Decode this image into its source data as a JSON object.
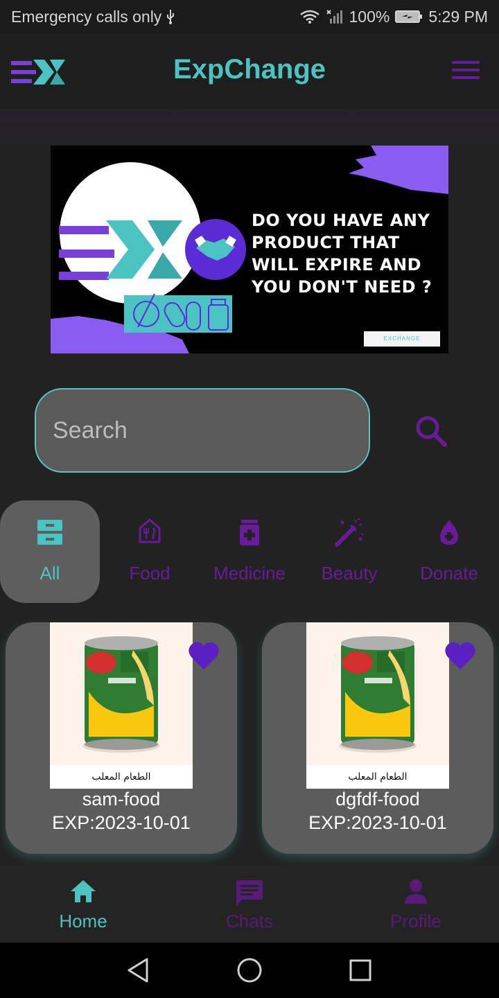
{
  "status_bar": {
    "carrier_text": "Emergency calls only",
    "battery": "100%",
    "time": "5:29 PM",
    "icons": [
      "usb-icon",
      "wifi-icon",
      "signal-icon",
      "battery-charging-icon"
    ]
  },
  "app_bar": {
    "title": "ExpChange",
    "logo_icon": "expchange-logo-icon",
    "menu_icon": "hamburger-menu-icon"
  },
  "banner": {
    "headline": "DO YOU HAVE ANY PRODUCT THAT WILL EXPIRE AND YOU DON'T NEED ?",
    "tag": "EXCHANGE",
    "icons": [
      "handshake-icon",
      "food-icon",
      "pills-icon",
      "bottle-icon"
    ]
  },
  "search": {
    "placeholder": "Search",
    "icon": "search-icon"
  },
  "categories": [
    {
      "label": "All",
      "icon": "inbox-icon",
      "active": true
    },
    {
      "label": "Food",
      "icon": "restaurant-icon",
      "active": false
    },
    {
      "label": "Medicine",
      "icon": "medication-icon",
      "active": false
    },
    {
      "label": "Beauty",
      "icon": "magic-wand-icon",
      "active": false
    },
    {
      "label": "Donate",
      "icon": "blood-drop-icon",
      "active": false
    }
  ],
  "products": [
    {
      "name": "sam-food",
      "exp": "EXP:2023-10-01",
      "image_caption": "الطعام المعلب",
      "favorite": true
    },
    {
      "name": "dgfdf-food",
      "exp": "EXP:2023-10-01",
      "image_caption": "الطعام المعلب",
      "favorite": true
    }
  ],
  "bottom_nav": [
    {
      "label": "Home",
      "icon": "home-icon",
      "active": true
    },
    {
      "label": "Chats",
      "icon": "chat-icon",
      "active": false
    },
    {
      "label": "Profile",
      "icon": "person-icon",
      "active": false
    }
  ],
  "colors": {
    "accent_teal": "#4cc3c3",
    "accent_purple": "#6a1b9a",
    "heart_purple": "#5b1fc2",
    "background": "#222222"
  }
}
